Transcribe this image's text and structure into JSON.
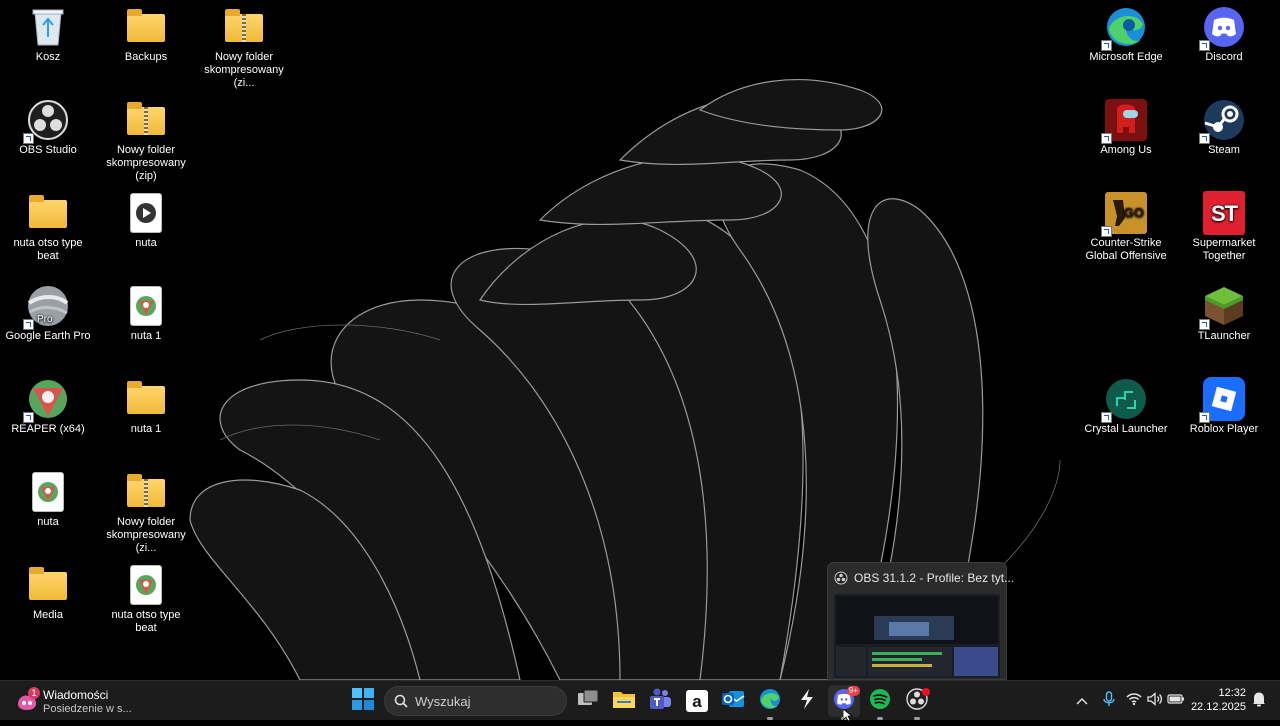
{
  "desktop": {
    "left_icons": [
      {
        "label": "Kosz",
        "icon": "recycle-bin-icon"
      },
      {
        "label": "Backups",
        "icon": "folder-icon"
      },
      {
        "label": "Nowy folder skompresowany (zi...",
        "icon": "zip-folder-icon"
      },
      {
        "label": "OBS Studio",
        "icon": "obs-icon"
      },
      {
        "label": "Nowy folder skompresowany (zip)",
        "icon": "zip-folder-icon"
      },
      {
        "label": "nuta otso type beat",
        "icon": "folder-icon"
      },
      {
        "label": "nuta",
        "icon": "video-file-icon"
      },
      {
        "label": "Google Earth Pro",
        "icon": "google-earth-icon"
      },
      {
        "label": "nuta 1",
        "icon": "reaper-project-icon"
      },
      {
        "label": "REAPER (x64)",
        "icon": "reaper-icon"
      },
      {
        "label": "nuta 1",
        "icon": "folder-icon"
      },
      {
        "label": "nuta",
        "icon": "reaper-project-icon"
      },
      {
        "label": "Nowy folder skompresowany (zi...",
        "icon": "zip-folder-icon"
      },
      {
        "label": "Media",
        "icon": "folder-icon"
      },
      {
        "label": "nuta otso type beat",
        "icon": "reaper-project-icon"
      }
    ],
    "right_icons": [
      {
        "label": "Microsoft Edge",
        "icon": "edge-icon"
      },
      {
        "label": "Discord",
        "icon": "discord-icon"
      },
      {
        "label": "Among Us",
        "icon": "among-us-icon"
      },
      {
        "label": "Steam",
        "icon": "steam-icon"
      },
      {
        "label": "Counter-Strike Global Offensive",
        "icon": "csgo-icon"
      },
      {
        "label": "Supermarket Together",
        "icon": "supermarket-together-icon"
      },
      {
        "label": "TLauncher",
        "icon": "tlauncher-icon"
      },
      {
        "label": "Crystal Launcher",
        "icon": "crystal-launcher-icon"
      },
      {
        "label": "Roblox Player",
        "icon": "roblox-icon"
      }
    ],
    "google_earth_badge": "Pro",
    "csgo_badge": "GO",
    "supermarket_badge": "ST"
  },
  "taskbar": {
    "widget": {
      "title": "Wiadomości",
      "subtitle": "Posiedzenie w s...",
      "badge": "1"
    },
    "search_placeholder": "Wyszukaj",
    "apps": [
      "start-icon",
      "task-view-icon",
      "file-explorer-icon",
      "teams-icon",
      "amazon-icon",
      "outlook-icon",
      "edge-icon",
      "lightning-app-icon",
      "discord-icon",
      "spotify-icon",
      "obs-icon"
    ],
    "discord_badge": "9+",
    "amazon_glyph": "a",
    "clock": {
      "time": "12:32",
      "date": "22.12.2025"
    }
  },
  "preview": {
    "title": "OBS 31.1.2 - Profile: Bez tyt..."
  },
  "colors": {
    "taskbar": "#1c1c1c",
    "accent": "#0078d4",
    "discord": "#5865f2",
    "spotify": "#1db954"
  }
}
